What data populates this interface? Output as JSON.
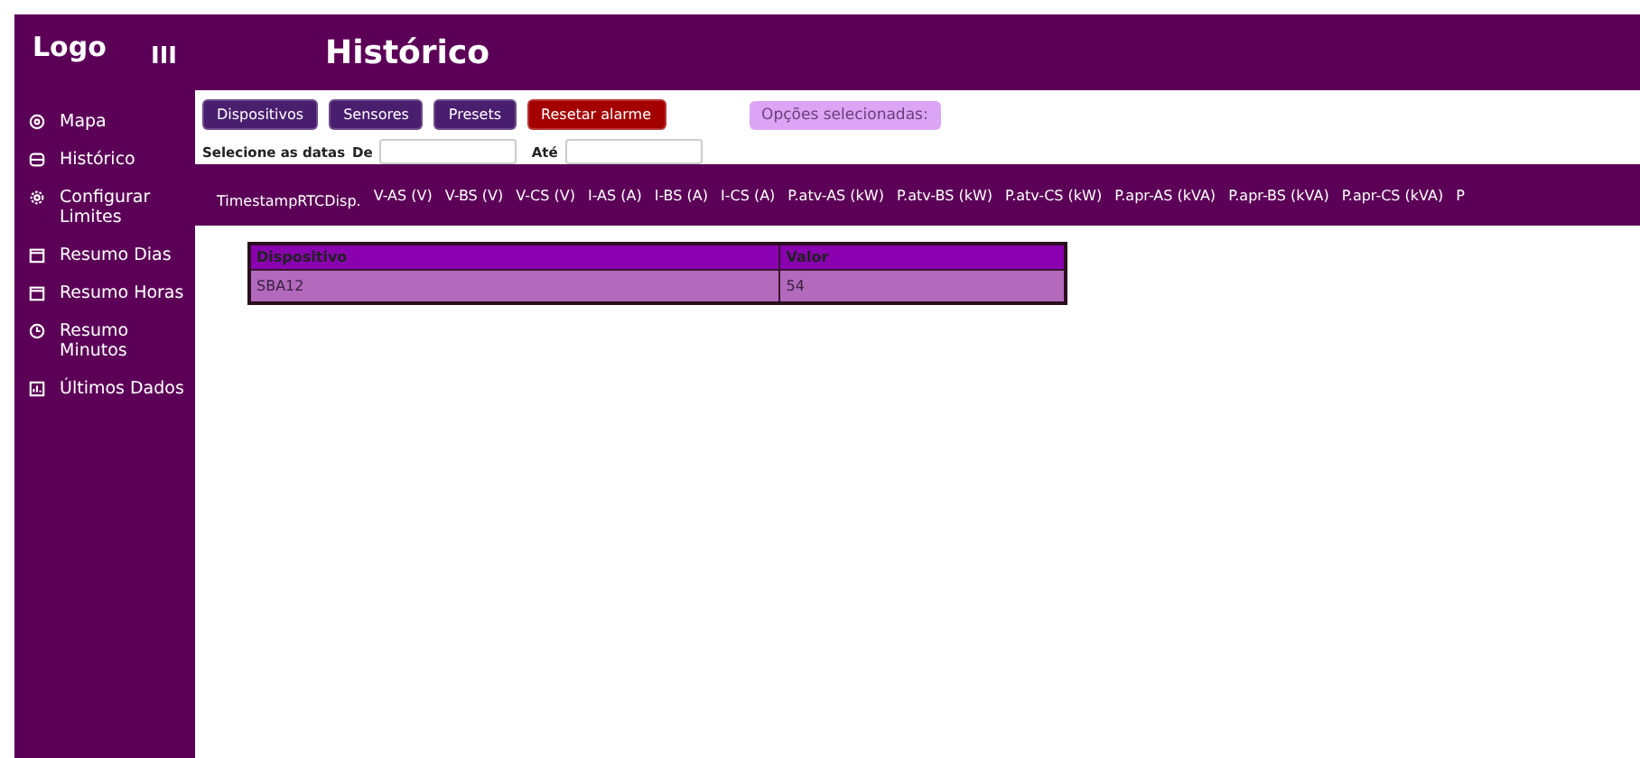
{
  "logo": "Logo",
  "menu_glyph": "III",
  "page_title": "Histórico",
  "sidebar": {
    "items": [
      {
        "label": "Mapa"
      },
      {
        "label": "Histórico"
      },
      {
        "label": "Configurar Limites"
      },
      {
        "label": "Resumo Dias"
      },
      {
        "label": "Resumo Horas"
      },
      {
        "label": "Resumo Minutos"
      },
      {
        "label": "Últimos Dados"
      }
    ]
  },
  "toolbar": {
    "buttons": [
      {
        "kind": "normal",
        "label": "Dispositivos"
      },
      {
        "kind": "normal",
        "label": "Sensores"
      },
      {
        "kind": "normal",
        "label": "Presets"
      },
      {
        "kind": "danger",
        "label": "Resetar alarme"
      }
    ],
    "selected_options": "Opções selecionadas:",
    "date_label": "Selecione as datas",
    "from_label": "De",
    "to_label": "Até"
  },
  "columns": [
    "TimestampRTCDisp.",
    "V-AS (V)",
    "V-BS (V)",
    "V-CS (V)",
    "I-AS (A)",
    "I-BS (A)",
    "I-CS (A)",
    "P.atv-AS (kW)",
    "P.atv-BS (kW)",
    "P.atv-CS (kW)",
    "P.apr-AS (kVA)",
    "P.apr-BS (kVA)",
    "P.apr-CS (kVA)",
    "P"
  ],
  "table": {
    "columns": [
      "Dispositivo",
      "Valor"
    ],
    "rows": [
      [
        "SBA12",
        "54"
      ]
    ]
  }
}
